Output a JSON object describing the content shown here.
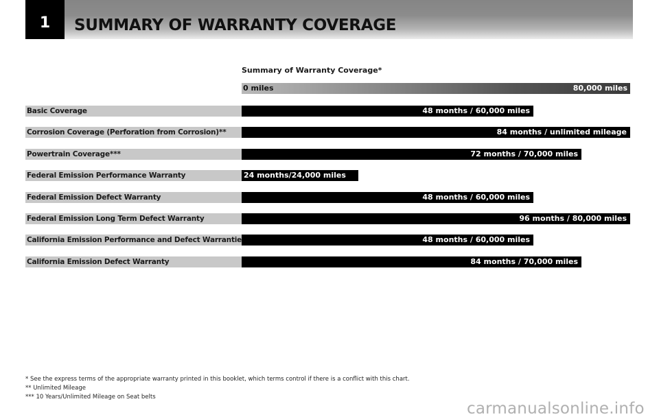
{
  "header": {
    "section_number": "1",
    "title": "SUMMARY OF WARRANTY COVERAGE"
  },
  "chart_data": {
    "type": "bar",
    "orientation": "horizontal",
    "title": "Summary of Warranty Coverage*",
    "scale": {
      "min_label": "0 miles",
      "max_label": "80,000 miles",
      "xlim": [
        0,
        80000
      ]
    },
    "categories": [
      "Basic Coverage",
      "Corrosion Coverage (Perforation from Corrosion)**",
      "Powertrain Coverage***",
      "Federal Emission Performance Warranty",
      "Federal Emission Defect Warranty",
      "Federal Emission Long Term Defect Warranty",
      "California Emission Performance and Defect Warranties",
      "California Emission Defect Warranty"
    ],
    "values": [
      60000,
      80000,
      70000,
      24000,
      60000,
      80000,
      60000,
      70000
    ],
    "data_labels": [
      "48 months / 60,000 miles",
      "84 months / unlimited mileage",
      "72 months / 70,000 miles",
      "24 months/24,000 miles",
      "48 months / 60,000 miles",
      "96 months / 80,000 miles",
      "48 months / 60,000 miles",
      "84 months / 70,000 miles"
    ],
    "months": [
      48,
      84,
      72,
      24,
      48,
      96,
      48,
      84
    ],
    "xlabel": "",
    "ylabel": "",
    "grid": false,
    "legend": "none"
  },
  "footnotes": [
    "* See the express terms of the appropriate warranty printed in this booklet, which terms control if there is a conflict with this chart.",
    "** Unlimited Mileage",
    "*** 10 Years/Unlimited Mileage on Seat belts"
  ],
  "watermark": "carmanualsonline.info"
}
